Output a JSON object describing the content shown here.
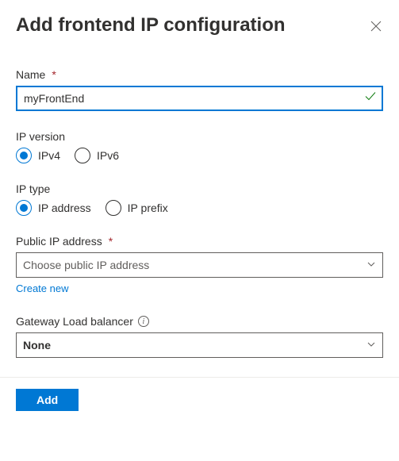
{
  "header": {
    "title": "Add frontend IP configuration"
  },
  "name": {
    "label": "Name",
    "value": "myFrontEnd"
  },
  "ip_version": {
    "label": "IP version",
    "options": {
      "ipv4": "IPv4",
      "ipv6": "IPv6"
    },
    "selected": "ipv4"
  },
  "ip_type": {
    "label": "IP type",
    "options": {
      "address": "IP address",
      "prefix": "IP prefix"
    },
    "selected": "address"
  },
  "public_ip": {
    "label": "Public IP address",
    "placeholder": "Choose public IP address",
    "create_new": "Create new"
  },
  "gateway_lb": {
    "label": "Gateway Load balancer",
    "value": "None"
  },
  "footer": {
    "add_label": "Add"
  }
}
